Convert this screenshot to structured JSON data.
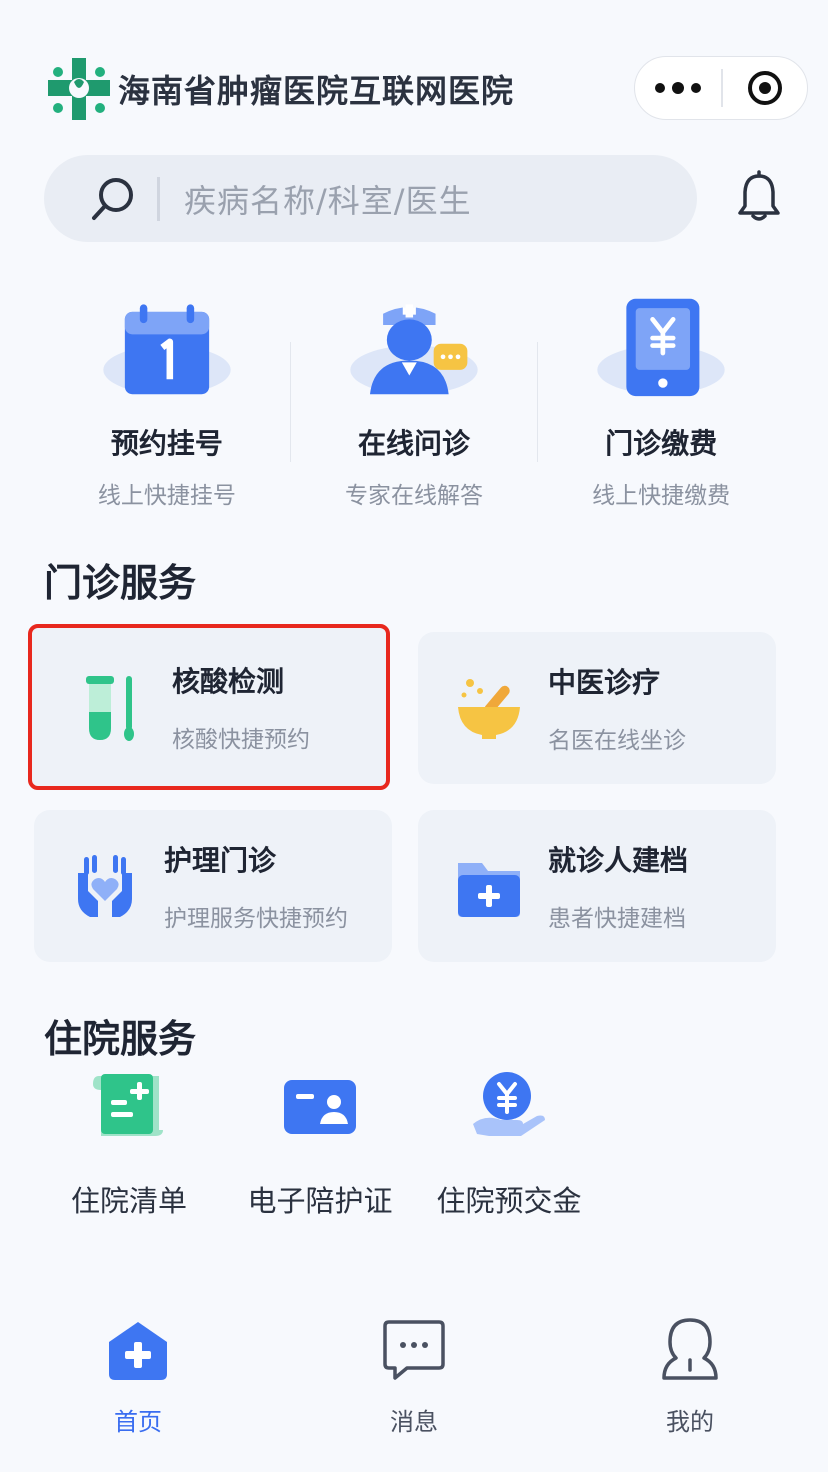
{
  "header": {
    "hospital_name": "海南省肿瘤医院互联网医院"
  },
  "search": {
    "placeholder": "疾病名称/科室/医生"
  },
  "quick_entries": [
    {
      "title": "预约挂号",
      "subtitle": "线上快捷挂号",
      "icon": "calendar-icon"
    },
    {
      "title": "在线问诊",
      "subtitle": "专家在线解答",
      "icon": "doctor-chat-icon"
    },
    {
      "title": "门诊缴费",
      "subtitle": "线上快捷缴费",
      "icon": "payment-phone-icon"
    }
  ],
  "outpatient": {
    "title": "门诊服务",
    "cards": [
      {
        "title": "核酸检测",
        "subtitle": "核酸快捷预约",
        "icon": "test-tube-icon"
      },
      {
        "title": "中医诊疗",
        "subtitle": "名医在线坐诊",
        "icon": "mortar-icon"
      },
      {
        "title": "护理门诊",
        "subtitle": "护理服务快捷预约",
        "icon": "care-hands-icon"
      },
      {
        "title": "就诊人建档",
        "subtitle": "患者快捷建档",
        "icon": "folder-plus-icon"
      }
    ]
  },
  "inpatient": {
    "title": "住院服务",
    "items": [
      {
        "label": "住院清单",
        "icon": "bill-icon"
      },
      {
        "label": "电子陪护证",
        "icon": "id-card-icon"
      },
      {
        "label": "住院预交金",
        "icon": "deposit-coin-icon"
      }
    ]
  },
  "tabbar": [
    {
      "label": "首页",
      "icon": "home-icon",
      "active": true
    },
    {
      "label": "消息",
      "icon": "message-icon",
      "active": false
    },
    {
      "label": "我的",
      "icon": "profile-icon",
      "active": false
    }
  ],
  "colors": {
    "accent": "#3a6df0",
    "highlight_border": "#e8281e",
    "logo_green": "#1f9a6e"
  }
}
